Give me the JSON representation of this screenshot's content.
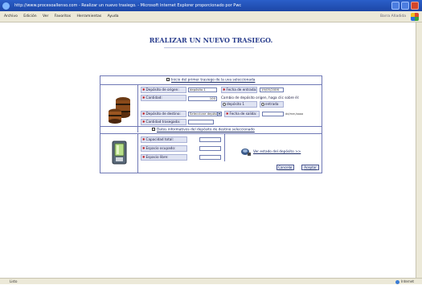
{
  "window": {
    "title": "http://www.procesoallenso.com - Realizar un nuevo trasiego. - Microsoft Internet Explorer proporcionado por Pwc"
  },
  "menubar": {
    "items": [
      "Archivo",
      "Edición",
      "Ver",
      "Favoritos",
      "Herramientas",
      "Ayuda"
    ],
    "right_label": "Barra Añadida"
  },
  "page": {
    "title": "REALIZAR UN NUEVO TRASIEGO."
  },
  "form": {
    "top_link": "Inicio del primer trasiego de la uva seleccionada",
    "origin_label": "Depósito de origen:",
    "origin_value": "depósito 1",
    "entry_date_label": "Fecha de entrada:",
    "entry_date_value": "19/05/2006",
    "quantity_label": "Cantidad:",
    "quantity_value": "100",
    "origin_change_text": "Cambio de depósito origen, haga clic sobre él:",
    "radio_origin": "depósito 1",
    "radio_entry": "entrada",
    "dest_label": "Depósito de destino:",
    "dest_value": "Seleccione depósito",
    "exit_date_label": "Fecha de salida:",
    "exit_date_hint": "dd/mm/aaaa",
    "transferred_label": "Cantidad trasegada:",
    "dest_info_link": "Datos informativos del depósito de destino seleccionado",
    "capacity_label": "Capacidad total:",
    "occupied_label": "Espacio ocupado:",
    "free_label": "Espacio libre:",
    "tank_state_link": "Ver estado del depósito >>",
    "cancel_button": "Cancelar",
    "accept_button": "Aceptar"
  },
  "status": {
    "left": "Listo",
    "zone": "Internet"
  },
  "colors": {
    "title": "#283c8c",
    "border": "#6f78b5",
    "required": "#c0161a"
  }
}
